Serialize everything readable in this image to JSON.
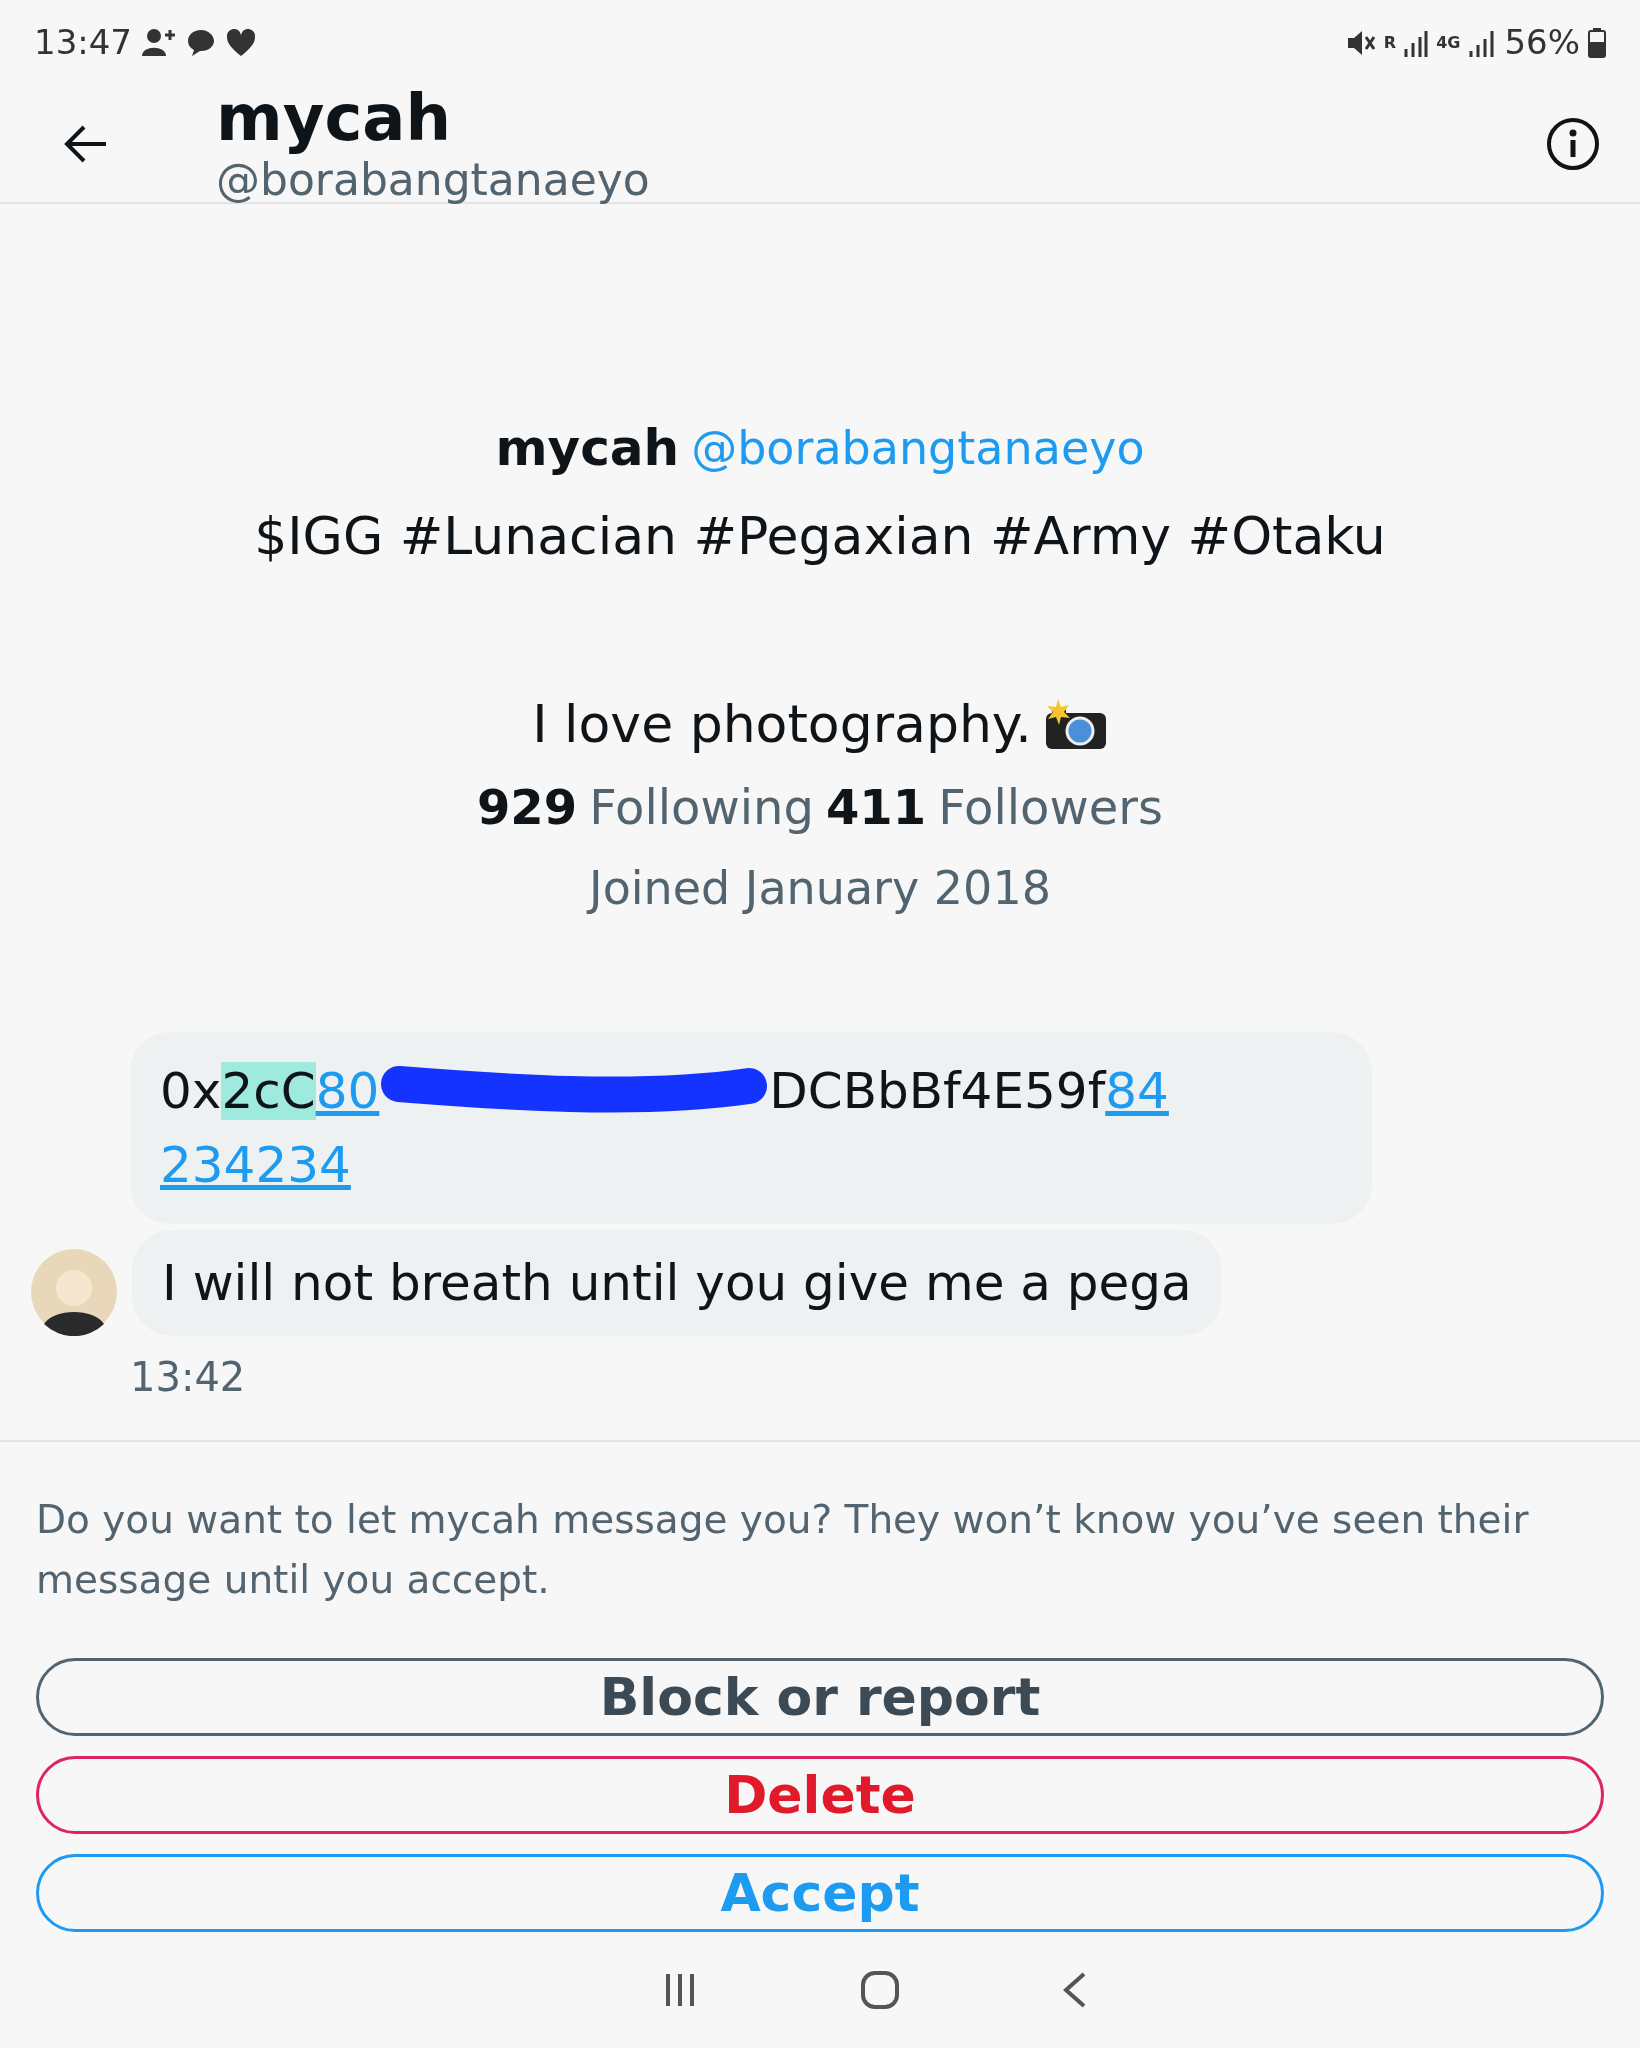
{
  "status_bar": {
    "time": "13:47",
    "roaming_label": "R",
    "network_label": "4G",
    "battery": "56%"
  },
  "header": {
    "name": "mycah",
    "handle": "@borabangtanaeyo"
  },
  "profile": {
    "name": "mycah",
    "handle": "@borabangtanaeyo",
    "bio": "$IGG #Lunacian #Pegaxian #Army #Otaku",
    "bio_line_2": "I love photography.",
    "following_count": "929",
    "following_label": "Following",
    "followers_count": "411",
    "followers_label": "Followers",
    "joined": "Joined January 2018"
  },
  "messages": [
    {
      "kind": "segments",
      "parts": [
        {
          "kind": "plain",
          "text": "0x"
        },
        {
          "kind": "highlighted",
          "text": "2cC"
        },
        {
          "kind": "link",
          "text": "80"
        },
        {
          "kind": "redaction"
        },
        {
          "kind": "plain",
          "text": "DCBbBf4E59f"
        },
        {
          "kind": "link",
          "text": "84"
        },
        {
          "kind": "break"
        },
        {
          "kind": "link",
          "text": "234234"
        }
      ]
    },
    {
      "kind": "text",
      "text": "I will not breath until you give me a pega"
    }
  ],
  "message_time": "13:42",
  "prompt": "Do you want to let mycah message you? They won’t know you’ve seen their message until you accept.",
  "buttons": [
    {
      "kind": "neutral",
      "label": "Block or report"
    },
    {
      "kind": "danger",
      "label": "Delete"
    },
    {
      "kind": "primary",
      "label": "Accept"
    }
  ]
}
